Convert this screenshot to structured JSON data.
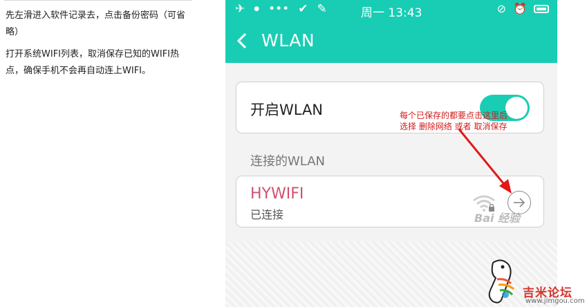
{
  "article": {
    "paragraph1": "先左滑进入软件记录去，点击备份密码（可省略）",
    "paragraph2": "打开系统WIFI列表，取消保存已知的WIFI热点，确保手机不会再自动连上WIFI。"
  },
  "phone": {
    "status_bar": {
      "time": "周一 13:43"
    },
    "app_bar": {
      "title": "WLAN"
    },
    "wlan_toggle": {
      "label": "开启WLAN",
      "state": "on"
    },
    "section_title": "连接的WLAN",
    "network": {
      "name": "HYWIFI",
      "status": "已连接"
    }
  },
  "annotation": {
    "line1": "每个已保存的都要点击这里后",
    "line2": "选择 删除网络 或者 取消保存"
  },
  "watermark": {
    "baidu": "Bai 经验"
  },
  "site_logo": {
    "name": "吉米论坛",
    "url": "www.jimgou.com"
  },
  "colors": {
    "accent": "#18cdb3",
    "network_name": "#d0506e",
    "annotation": "#d11b1b"
  }
}
